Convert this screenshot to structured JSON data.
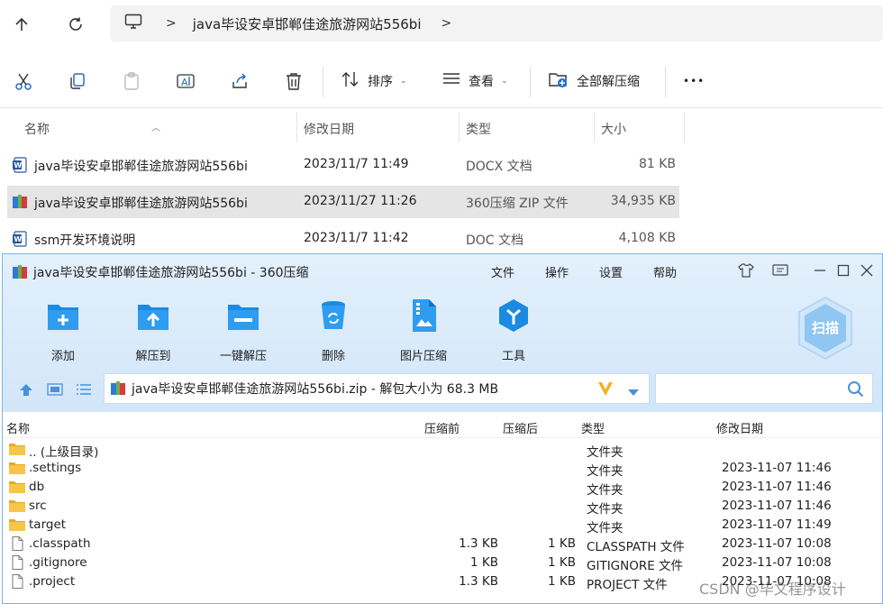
{
  "explorer": {
    "breadcrumb": "java毕设安卓邯郸佳途旅游网站556bi",
    "breadcrumb_sep": ">",
    "toolbar": {
      "sort_label": "排序",
      "view_label": "查看",
      "extract_all_label": "全部解压缩",
      "more_label": "•••"
    },
    "columns": {
      "name": "名称",
      "modified": "修改日期",
      "type": "类型",
      "size": "大小"
    },
    "files": [
      {
        "name": "java毕设安卓邯郸佳途旅游网站556bi",
        "modified": "2023/11/7 11:49",
        "type": "DOCX 文档",
        "size": "81 KB",
        "icon": "word-doc-icon"
      },
      {
        "name": "java毕设安卓邯郸佳途旅游网站556bi",
        "modified": "2023/11/27 11:26",
        "type": "360压缩 ZIP 文件",
        "size": "34,935 KB",
        "icon": "zip-archive-icon",
        "selected": true
      },
      {
        "name": "ssm开发环境说明",
        "modified": "2023/11/7 11:42",
        "type": "DOC 文档",
        "size": "4,108 KB",
        "icon": "word-doc-icon"
      }
    ]
  },
  "zip": {
    "title": "java毕设安卓邯郸佳途旅游网站556bi - 360压缩",
    "menu": [
      "文件",
      "操作",
      "设置",
      "帮助"
    ],
    "tools": [
      "添加",
      "解压到",
      "一键解压",
      "删除",
      "图片压缩",
      "工具"
    ],
    "scan_label": "扫描",
    "path_text": "java毕设安卓邯郸佳途旅游网站556bi.zip - 解包大小为 68.3 MB",
    "columns": {
      "name": "名称",
      "before": "压缩前",
      "after": "压缩后",
      "type": "类型",
      "modified": "修改日期"
    },
    "rows": [
      {
        "name": ".. (上级目录)",
        "before": "",
        "after": "",
        "type": "文件夹",
        "modified": "",
        "icon": "folder-icon"
      },
      {
        "name": ".settings",
        "before": "",
        "after": "",
        "type": "文件夹",
        "modified": "2023-11-07 11:46",
        "icon": "folder-icon"
      },
      {
        "name": "db",
        "before": "",
        "after": "",
        "type": "文件夹",
        "modified": "2023-11-07 11:46",
        "icon": "folder-icon"
      },
      {
        "name": "src",
        "before": "",
        "after": "",
        "type": "文件夹",
        "modified": "2023-11-07 11:46",
        "icon": "folder-icon"
      },
      {
        "name": "target",
        "before": "",
        "after": "",
        "type": "文件夹",
        "modified": "2023-11-07 11:49",
        "icon": "folder-icon"
      },
      {
        "name": ".classpath",
        "before": "1.3 KB",
        "after": "1 KB",
        "type": "CLASSPATH 文件",
        "modified": "2023-11-07 10:08",
        "icon": "file-icon"
      },
      {
        "name": ".gitignore",
        "before": "1 KB",
        "after": "1 KB",
        "type": "GITIGNORE 文件",
        "modified": "2023-11-07 10:08",
        "icon": "file-icon"
      },
      {
        "name": ".project",
        "before": "1.3 KB",
        "after": "1 KB",
        "type": "PROJECT 文件",
        "modified": "2023-11-07 10:08",
        "icon": "file-icon"
      }
    ]
  },
  "watermark": "CSDN @毕文程序设计"
}
